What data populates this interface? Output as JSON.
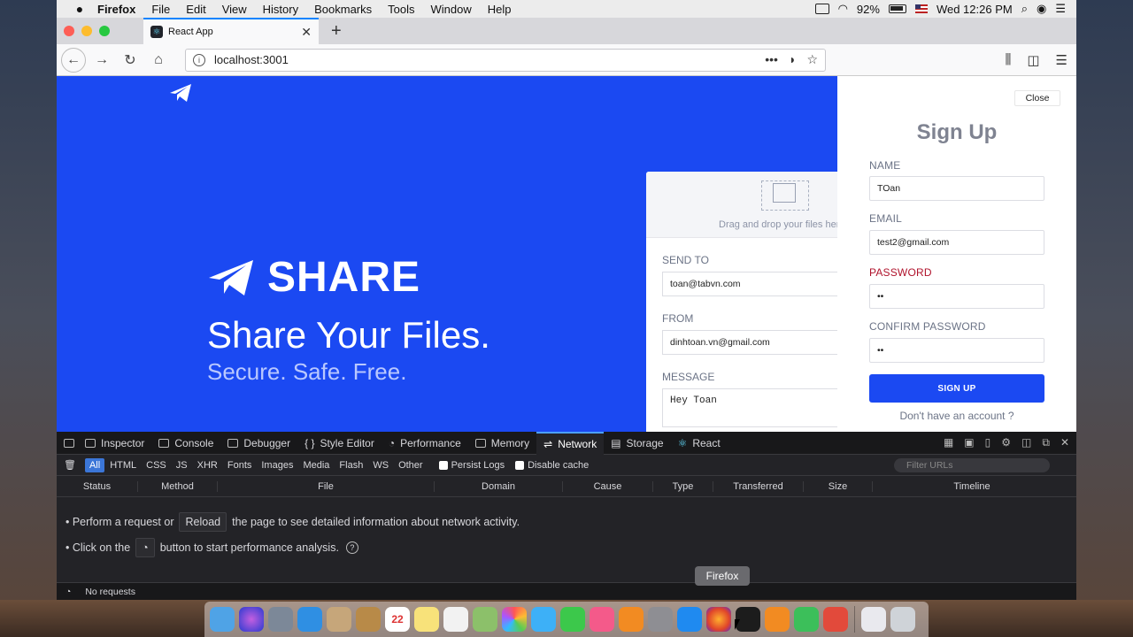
{
  "menubar": {
    "app": "Firefox",
    "items": [
      "File",
      "Edit",
      "View",
      "History",
      "Bookmarks",
      "Tools",
      "Window",
      "Help"
    ],
    "battery": "92%",
    "clock": "Wed 12:26 PM"
  },
  "browser": {
    "tab_title": "React App",
    "url": "localhost:3001"
  },
  "page": {
    "brand": "SHARE",
    "tagline": "Share Your Files.",
    "subtagline": "Secure. Safe. Free.",
    "accent_color": "#1b49f2"
  },
  "send_form": {
    "drop_text": "Drag and drop your files here",
    "send_to_label": "SEND TO",
    "send_to_value": "toan@tabvn.com",
    "from_label": "FROM",
    "from_value": "dinhtoan.vn@gmail.com",
    "message_label": "MESSAGE",
    "message_value": "Hey Toan"
  },
  "signup": {
    "close_label": "Close",
    "title": "Sign Up",
    "name_label": "NAME",
    "name_value": "TOan",
    "email_label": "EMAIL",
    "email_value": "test2@gmail.com",
    "password_label": "PASSWORD",
    "password_value": "••",
    "confirm_label": "CONFIRM PASSWORD",
    "confirm_value": "••",
    "submit_label": "SIGN UP",
    "no_account": "Don't have an account ?",
    "error_color": "#b0132c"
  },
  "devtools": {
    "tabs": [
      "Inspector",
      "Console",
      "Debugger",
      "Style Editor",
      "Performance",
      "Memory",
      "Network",
      "Storage",
      "React"
    ],
    "active_tab": "Network",
    "filters": [
      "All",
      "HTML",
      "CSS",
      "JS",
      "XHR",
      "Fonts",
      "Images",
      "Media",
      "Flash",
      "WS",
      "Other"
    ],
    "persist_logs": "Persist Logs",
    "disable_cache": "Disable cache",
    "filter_placeholder": "Filter URLs",
    "columns": [
      "Status",
      "Method",
      "File",
      "Domain",
      "Cause",
      "Type",
      "Transferred",
      "Size",
      "Timeline"
    ],
    "line1_a": "• Perform a request or",
    "line1_btn": "Reload",
    "line1_b": "the page to see detailed information about network activity.",
    "line2_a": "• Click on the",
    "line2_b": "button to start performance analysis.",
    "status": "No requests"
  },
  "dock": {
    "tooltip": "Firefox",
    "calendar_day": "22"
  }
}
